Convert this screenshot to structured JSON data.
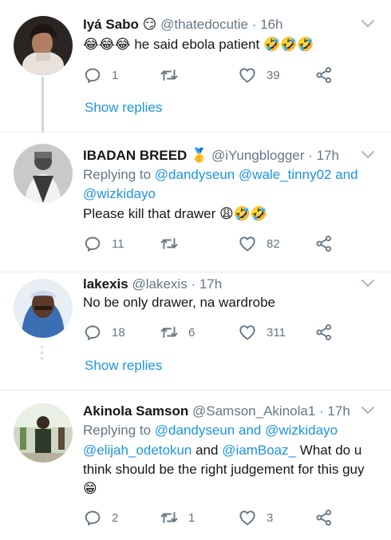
{
  "tweets": [
    {
      "name": "Iyá Sabo",
      "name_emoji": "😏",
      "handle": "@thatedocutie",
      "time": "· 16h",
      "text_prefix_emoji": "😂😂😂",
      "text": "he said ebola patient",
      "text_suffix_emoji": "🤣🤣🤣",
      "replies": "1",
      "retweets": "",
      "likes": "39",
      "show_replies": "Show replies"
    },
    {
      "name": "IBADAN BREED",
      "name_emoji": "🥇",
      "handle": "@iYungblogger",
      "time": "· 17h",
      "replying_label": "Replying to",
      "replying_1": "@dandyseun",
      "replying_2": "@wale_tinny02",
      "replying_and": "and",
      "replying_3": "@wizkidayo",
      "text": "Please kill that drawer",
      "text_suffix_emoji": "😩🤣🤣",
      "replies": "11",
      "retweets": "",
      "likes": "82"
    },
    {
      "name": "lakexis",
      "handle": "@lakexis",
      "time": "· 17h",
      "text": "No be only drawer, na wardrobe",
      "replies": "18",
      "retweets": "6",
      "likes": "311",
      "show_replies": "Show replies"
    },
    {
      "name": "Akinola Samson",
      "handle": "@Samson_Akinola1",
      "time": "· 17h",
      "replying_label": "Replying to",
      "replying_1": "@dandyseun",
      "replying_and": "and",
      "replying_2": "@wizkidayo",
      "mention_1": "@elijah_odetokun",
      "mention_and": "and",
      "mention_2": "@iamBoaz_",
      "text_1": "What do u",
      "text_2": "think should be the right judgement for this guy",
      "text_suffix_emoji": "😁",
      "replies": "2",
      "retweets": "1",
      "likes": "3"
    }
  ],
  "icons": {
    "reply": "reply-icon",
    "retweet": "retweet-icon",
    "like": "heart-icon",
    "share": "share-icon",
    "more": "chevron-down-icon"
  },
  "colors": {
    "link": "#1b95e0",
    "muted": "#657786",
    "icon": "#657786",
    "thread_line": "#ccd6dd",
    "divider": "#e6ecf0"
  }
}
